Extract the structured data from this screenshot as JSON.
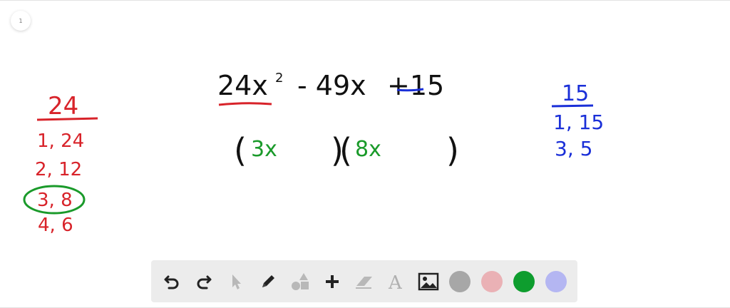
{
  "page": {
    "number": "1"
  },
  "board": {
    "expression": {
      "term1": "24x",
      "exponent": "2",
      "term2": "- 49x",
      "term3": "+15"
    },
    "factoring": {
      "open1": "(",
      "a": "3x",
      "close1": ")",
      "open2": "(",
      "b": "8x",
      "close2": ")"
    },
    "left_factors": {
      "title": "24",
      "pairs": [
        "1, 24",
        "2, 12",
        "3, 8",
        "4, 6"
      ],
      "circled": "3, 8"
    },
    "right_factors": {
      "title": "15",
      "pairs": [
        "1, 15",
        "3, 5"
      ]
    }
  },
  "colors": {
    "red": "#d8232a",
    "blue": "#1a2fd8",
    "green": "#1a9a2a",
    "black": "#111111"
  },
  "toolbar": {
    "tools": [
      {
        "name": "undo-icon"
      },
      {
        "name": "redo-icon"
      },
      {
        "name": "select-arrow-icon"
      },
      {
        "name": "pencil-icon"
      },
      {
        "name": "shapes-icon"
      },
      {
        "name": "plus-icon"
      },
      {
        "name": "eraser-icon"
      },
      {
        "name": "text-icon"
      },
      {
        "name": "image-icon"
      }
    ],
    "swatches": [
      {
        "name": "color-gray",
        "color": "#a7a7a7"
      },
      {
        "name": "color-pink",
        "color": "#eab1b5"
      },
      {
        "name": "color-green",
        "color": "#0e9d2e"
      },
      {
        "name": "color-lavender",
        "color": "#b4b6f2"
      }
    ]
  }
}
